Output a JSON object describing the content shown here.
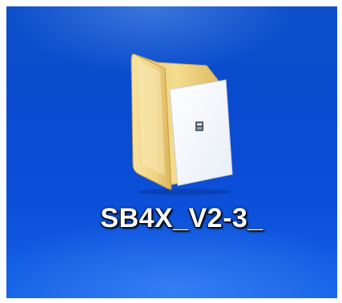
{
  "desktop": {
    "background_color": "#0b4ed8",
    "icon": {
      "type": "folder-icon",
      "label": "SB4X_V2-3_",
      "folder_color": "#f3d98a"
    }
  }
}
